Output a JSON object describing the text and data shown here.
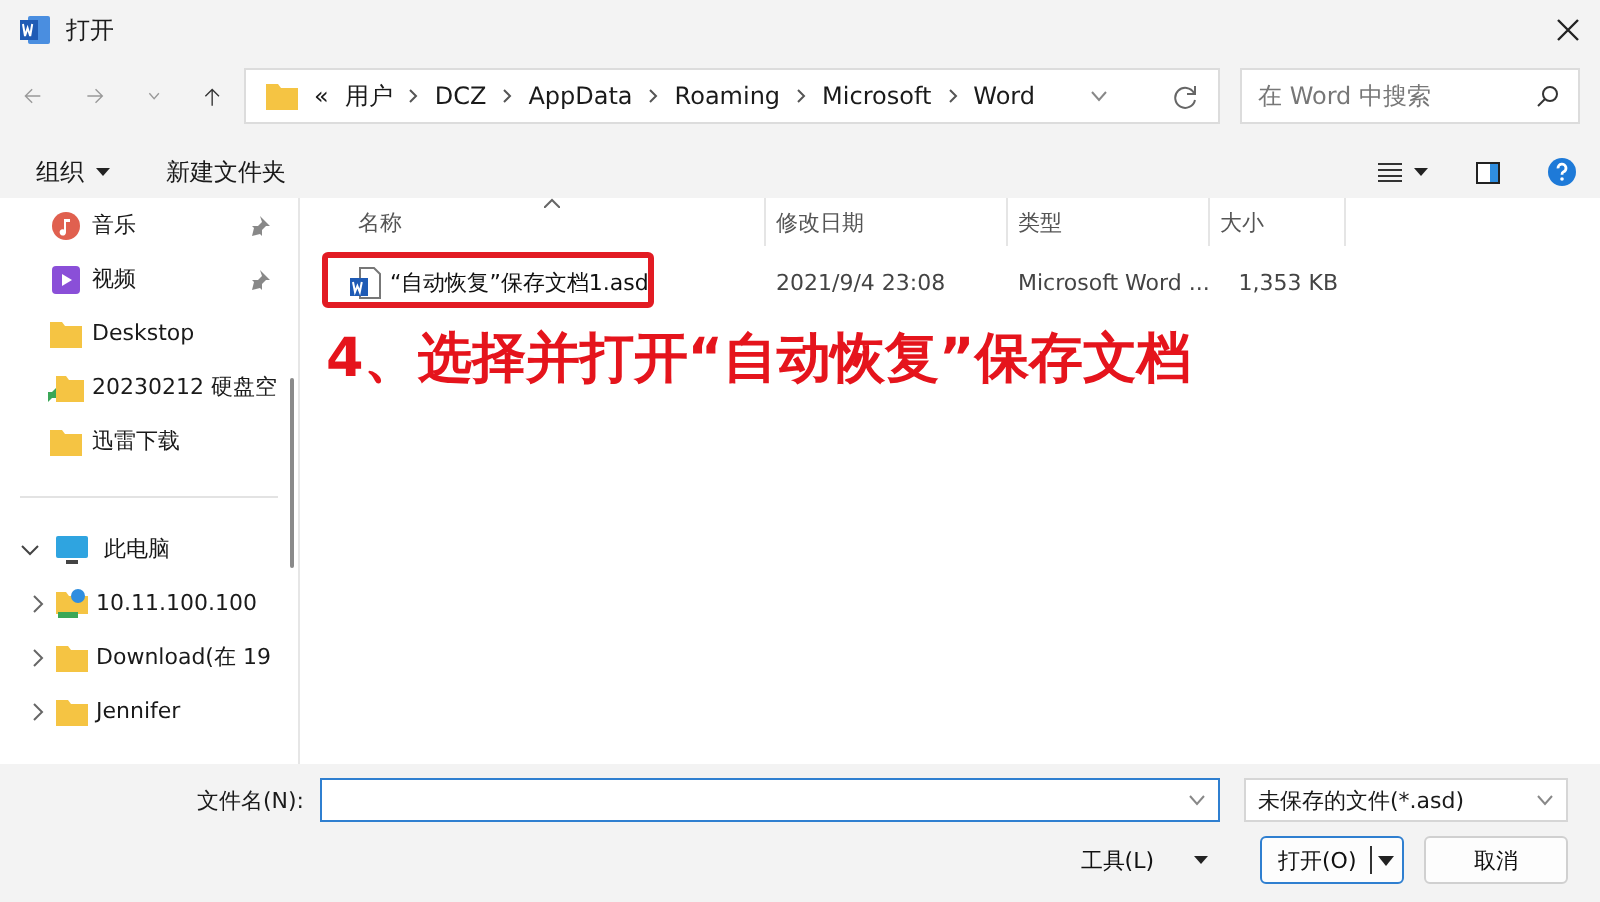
{
  "window": {
    "title": "打开"
  },
  "address_bar": {
    "overflow": "«",
    "path": [
      "用户",
      "DCZ",
      "AppData",
      "Roaming",
      "Microsoft",
      "Word"
    ]
  },
  "search": {
    "placeholder": "在 Word 中搜索"
  },
  "toolbar": {
    "organize": "组织",
    "new_folder": "新建文件夹"
  },
  "sidebar": {
    "quick_access": [
      {
        "label": "音乐",
        "kind": "music",
        "pinned": true
      },
      {
        "label": "视频",
        "kind": "video",
        "pinned": true
      },
      {
        "label": "Deskstop",
        "kind": "folder",
        "pinned": false
      },
      {
        "label": "20230212 硬盘空",
        "kind": "shared",
        "pinned": false
      },
      {
        "label": "迅雷下载",
        "kind": "folder",
        "pinned": false
      }
    ],
    "this_pc": {
      "label": "此电脑",
      "expanded": true,
      "children": [
        {
          "label": "10.11.100.100",
          "kind": "network",
          "expanded": false
        },
        {
          "label": "Download(在 19",
          "kind": "folder",
          "expanded": false
        },
        {
          "label": "Jennifer",
          "kind": "folder",
          "expanded": false
        }
      ]
    }
  },
  "file_list": {
    "columns": [
      "名称",
      "修改日期",
      "类型",
      "大小"
    ],
    "rows": [
      {
        "name": "“自动恢复”保存文档1.asd",
        "modified": "2021/9/4 23:08",
        "type": "Microsoft Word ...",
        "size": "1,353 KB",
        "selected": false
      }
    ]
  },
  "annotation": {
    "text": "4、选择并打开“自动恢复”保存文档"
  },
  "footer": {
    "filename_label": "文件名(N):",
    "file_type": "未保存的文件(*.asd)",
    "tools": "工具(L)",
    "open": "打开(O)",
    "cancel": "取消"
  }
}
